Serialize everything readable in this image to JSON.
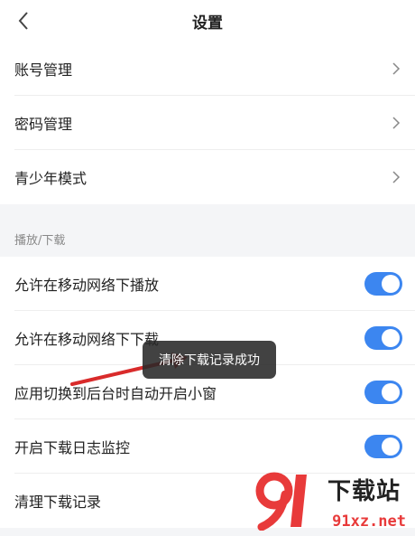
{
  "header": {
    "title": "设置"
  },
  "account_group": [
    {
      "label": "账号管理"
    },
    {
      "label": "密码管理"
    },
    {
      "label": "青少年模式"
    }
  ],
  "section": {
    "title": "播放/下载"
  },
  "toggle_rows": [
    {
      "label": "允许在移动网络下播放",
      "on": true
    },
    {
      "label": "允许在移动网络下下载",
      "on": true
    },
    {
      "label": "应用切换到后台时自动开启小窗",
      "on": true
    },
    {
      "label": "开启下载日志监控",
      "on": true
    }
  ],
  "clear_row": {
    "label": "清理下载记录"
  },
  "toast": {
    "text": "清除下载记录成功"
  },
  "watermark": {
    "title": "下载站",
    "url": "91xz.net"
  },
  "colors": {
    "accent": "#3c86f0",
    "arrow": "#d92b2b",
    "watermark_red": "#e83a3a"
  }
}
